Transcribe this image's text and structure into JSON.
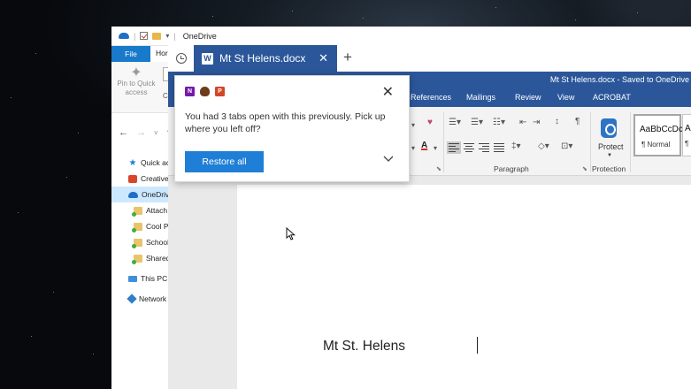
{
  "explorer": {
    "title": "OneDrive",
    "tabs": {
      "file": "File",
      "home": "Hor"
    },
    "ribbon": {
      "pin_label": "Pin to Quick access",
      "copy_label": "C"
    },
    "nav": {
      "back": "←",
      "forward": "→",
      "dropdown": "˅",
      "up": "↑"
    },
    "tree": [
      {
        "label": "Quick ac",
        "icon": "quick-access-star-icon"
      },
      {
        "label": "Creative",
        "icon": "creative-cloud-icon"
      },
      {
        "label": "OneDriv",
        "icon": "onedrive-cloud-icon",
        "selected": true
      },
      {
        "label": "Attach",
        "icon": "synced-folder-icon"
      },
      {
        "label": "Cool P",
        "icon": "synced-folder-icon"
      },
      {
        "label": "School",
        "icon": "synced-folder-icon"
      },
      {
        "label": "Shared",
        "icon": "synced-folder-icon"
      },
      {
        "label": "This PC",
        "icon": "this-pc-icon"
      },
      {
        "label": "Network",
        "icon": "network-icon"
      }
    ]
  },
  "word": {
    "tab_title": "Mt St Helens.docx",
    "tab_icon_letter": "W",
    "tab_close": "✕",
    "new_tab": "+",
    "window_title": "Mt St Helens.docx - Saved to OneDrive",
    "ribbon_tabs": [
      "References",
      "Mailings",
      "Review",
      "View",
      "ACROBAT"
    ],
    "groups": {
      "paragraph": "Paragraph",
      "protection": "Protection"
    },
    "protect_label": "Protect",
    "styles": [
      {
        "sample": "AaBbCcDc",
        "name": "¶ Normal"
      },
      {
        "sample": "A",
        "name": "¶"
      }
    ],
    "document_text": "Mt St. Helens"
  },
  "popup": {
    "apps": [
      {
        "letter": "N",
        "icon": "onenote-icon"
      },
      {
        "letter": "",
        "icon": "badge-icon"
      },
      {
        "letter": "P",
        "icon": "powerpoint-icon"
      }
    ],
    "close": "✕",
    "message": "You had 3 tabs open with this previously. Pick up where you left off?",
    "restore_label": "Restore all"
  },
  "colors": {
    "word_blue": "#2b579a",
    "button_blue": "#1f7fd6",
    "selection": "#cce8ff"
  }
}
